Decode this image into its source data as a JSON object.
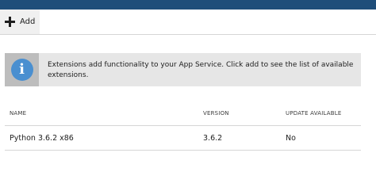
{
  "toolbar": {
    "add_label": "Add"
  },
  "info_banner": {
    "text": "Extensions add functionality to your App Service. Click add to see the list of available extensions.",
    "icon": "info-icon"
  },
  "table": {
    "columns": [
      "NAME",
      "VERSION",
      "UPDATE AVAILABLE"
    ],
    "rows": [
      {
        "name": "Python 3.6.2 x86",
        "version": "3.6.2",
        "update_available": "No"
      }
    ]
  },
  "colors": {
    "topbar": "#1f4e7a",
    "info_icon": "#4a8fd0",
    "banner_bg": "#e6e6e6"
  }
}
